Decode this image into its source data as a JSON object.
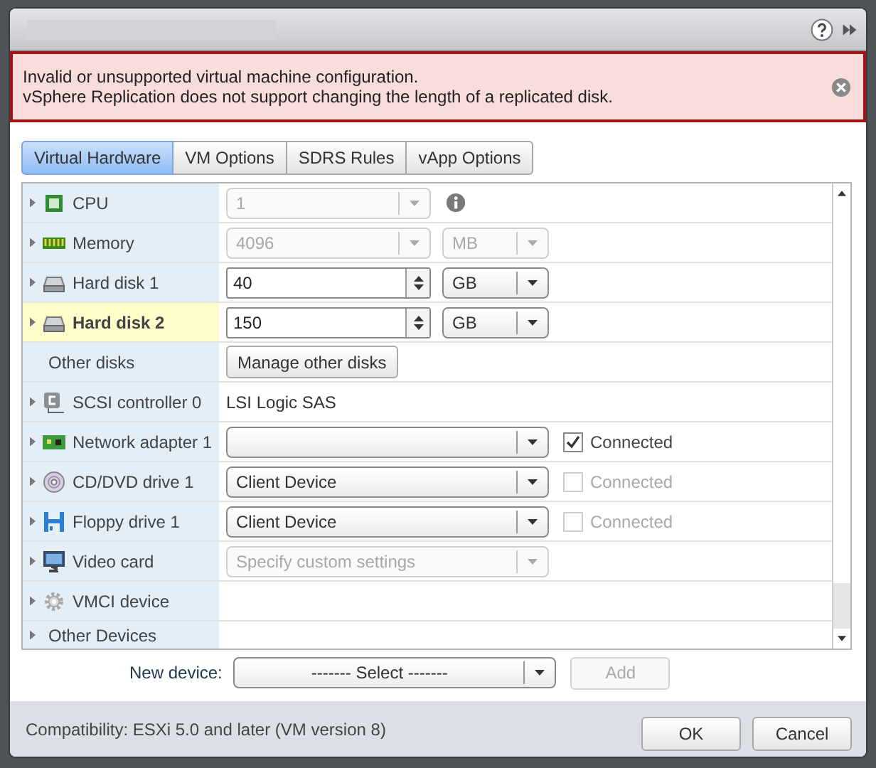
{
  "error": {
    "lines": [
      "Invalid or unsupported virtual machine configuration.",
      "vSphere Replication does not support changing the length of a replicated disk."
    ]
  },
  "tabs": [
    {
      "label": "Virtual Hardware",
      "selected": true
    },
    {
      "label": "VM Options",
      "selected": false
    },
    {
      "label": "SDRS Rules",
      "selected": false
    },
    {
      "label": "vApp Options",
      "selected": false
    }
  ],
  "hardware": [
    {
      "label": "CPU",
      "expanded": false,
      "selected": false,
      "control": {
        "kind": "short-select",
        "value": "1",
        "disabled": true
      },
      "info": true
    },
    {
      "label": "Memory",
      "expanded": false,
      "selected": false,
      "control": {
        "kind": "short-select",
        "value": "4096",
        "disabled": true
      },
      "unit": {
        "value": "MB",
        "disabled": true
      }
    },
    {
      "label": "Hard disk 1",
      "expanded": false,
      "selected": false,
      "control": {
        "kind": "spinner",
        "value": "40",
        "disabled": false
      },
      "unit": {
        "value": "GB",
        "disabled": false
      }
    },
    {
      "label": "Hard disk 2",
      "expanded": false,
      "selected": true,
      "control": {
        "kind": "spinner",
        "value": "150",
        "disabled": false
      },
      "unit": {
        "value": "GB",
        "disabled": false
      }
    },
    {
      "label": "Other disks",
      "selected": false,
      "control": {
        "kind": "button",
        "value": "Manage other disks",
        "disabled": false
      }
    },
    {
      "label": "SCSI controller 0",
      "expanded": false,
      "selected": false,
      "control": {
        "kind": "text",
        "value": "LSI Logic SAS"
      }
    },
    {
      "label": "Network adapter 1",
      "expanded": false,
      "selected": false,
      "control": {
        "kind": "select",
        "disabled": false
      },
      "checkbox": {
        "label": "Connected",
        "checked": true,
        "disabled": false
      }
    },
    {
      "label": "CD/DVD drive 1",
      "expanded": false,
      "selected": false,
      "control": {
        "kind": "select",
        "value": "Client Device",
        "disabled": false
      },
      "checkbox": {
        "label": "Connected",
        "checked": false,
        "disabled": true
      }
    },
    {
      "label": "Floppy drive 1",
      "expanded": false,
      "selected": false,
      "control": {
        "kind": "select",
        "value": "Client Device",
        "disabled": false
      },
      "checkbox": {
        "label": "Connected",
        "checked": false,
        "disabled": true
      }
    },
    {
      "label": "Video card",
      "expanded": false,
      "selected": false,
      "control": {
        "kind": "select",
        "value": "Specify custom settings",
        "disabled": true
      }
    },
    {
      "label": "VMCI device",
      "expanded": false,
      "selected": false
    },
    {
      "label": "Other Devices",
      "expanded": false,
      "selected": false
    }
  ],
  "new_device": {
    "label": "New device:",
    "select": "------- Select -------",
    "add": {
      "label": "Add",
      "disabled": true
    }
  },
  "footer": {
    "compatibility": "Compatibility: ESXi 5.0 and later (VM version 8)",
    "buttons": [
      "OK",
      "Cancel"
    ]
  }
}
